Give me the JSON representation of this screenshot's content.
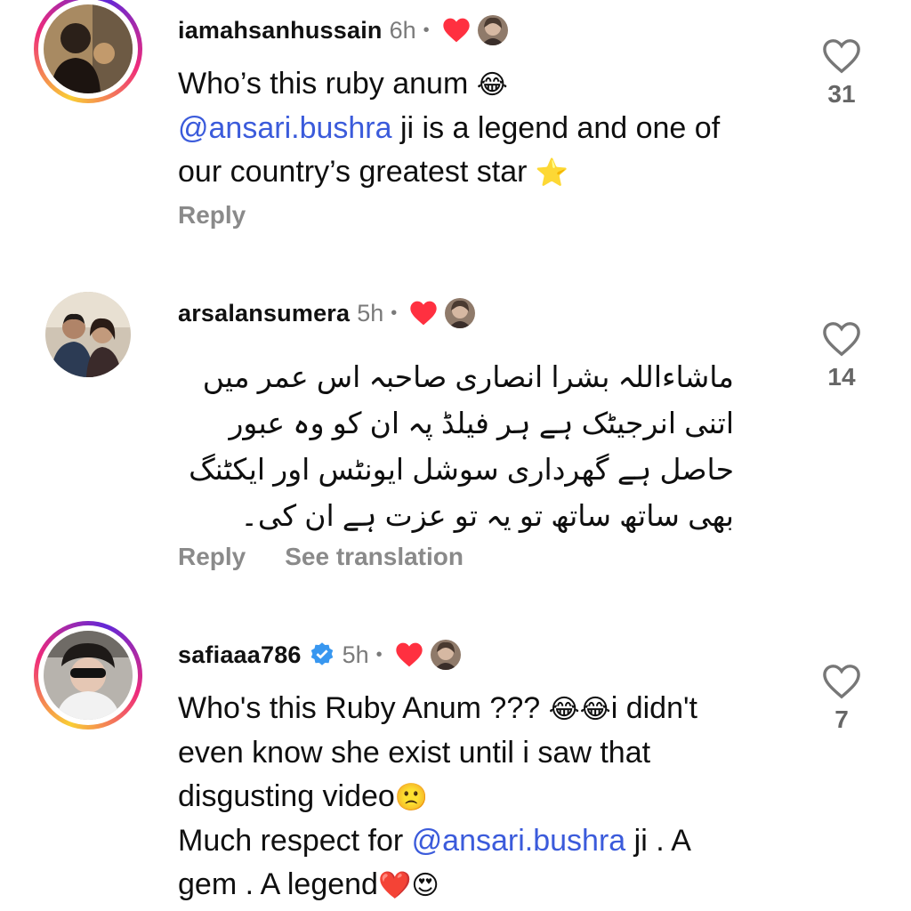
{
  "comments": [
    {
      "username": "iamahsanhussain",
      "time": "6h",
      "dot": "•",
      "text_parts": [
        "Who’s this ruby anum ",
        "😂",
        "\n",
        "@ansari.bushra",
        " ji is a legend and one of our country’s greatest star ",
        "⭐"
      ],
      "actions": {
        "reply": "Reply"
      },
      "likes": "31"
    },
    {
      "username": "arsalansumera",
      "time": "5h",
      "dot": "•",
      "text": "ماشاءاللہ بشرا انصاری صاحبہ اس عمر میں اتنی انرجیٹک ہے ہر فیلڈ پہ ان کو وہ عبور حاصل ہے گھرداری سوشل ایونٹس اور ایکٹنگ بھی ساتھ ساتھ تو یہ تو عزت ہے ان کی۔",
      "actions": {
        "reply": "Reply",
        "translate": "See translation"
      },
      "likes": "14"
    },
    {
      "username": "safiaaa786",
      "time": "5h",
      "dot": "•",
      "text_parts": [
        "Who's this Ruby Anum ??? ",
        "😂😂",
        "i didn't even know she exist until i saw that disgusting video",
        "🙁",
        "\nMuch respect for ",
        "@ansari.bushra",
        " ji . A gem . A legend",
        "❤️",
        "😍"
      ],
      "likes": "7"
    }
  ],
  "colors": {
    "heart": "#ff3040",
    "mention": "#3b5bdb",
    "verified": "#3897f0",
    "muted": "#7a7a7a"
  },
  "icons": [
    "heart-filled-icon",
    "heart-outline-icon",
    "verified-badge-icon"
  ]
}
